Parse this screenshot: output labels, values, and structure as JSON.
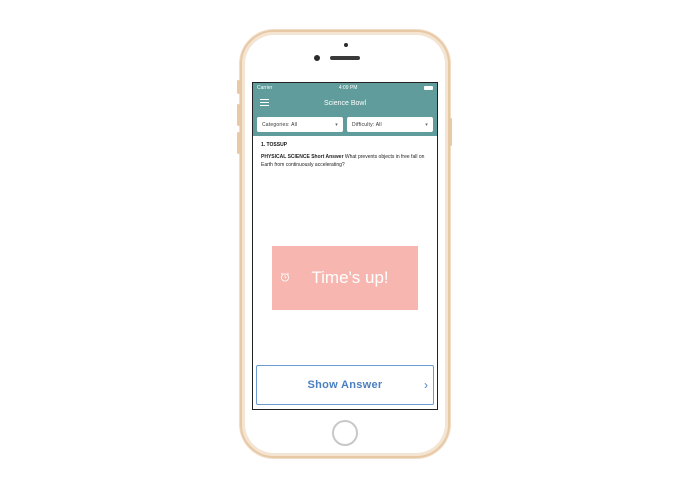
{
  "status_bar": {
    "carrier": "Carrier",
    "time": "4:09 PM"
  },
  "nav": {
    "title": "Science Bowl",
    "menu_icon": "hamburger-icon"
  },
  "filters": {
    "categories": "Categories: All",
    "difficulty": "Difficulty: All",
    "dropdown_icon": "chevron-down-icon"
  },
  "question": {
    "number": "1. TOSSUP",
    "subject": "PHYSICAL SCIENCE Short Answer",
    "text": "What prevents objects in free fall on Earth from continuously accelerating?"
  },
  "timer": {
    "label": "Time's up!",
    "icon": "alarm-clock-icon",
    "color": "#f7b7b0"
  },
  "show_answer": {
    "label": "Show Answer",
    "icon": "chevron-right-icon"
  },
  "colors": {
    "accent": "#5f9c9b",
    "button_text": "#4a7fbf",
    "phone_frame": "#e8c9a6"
  }
}
